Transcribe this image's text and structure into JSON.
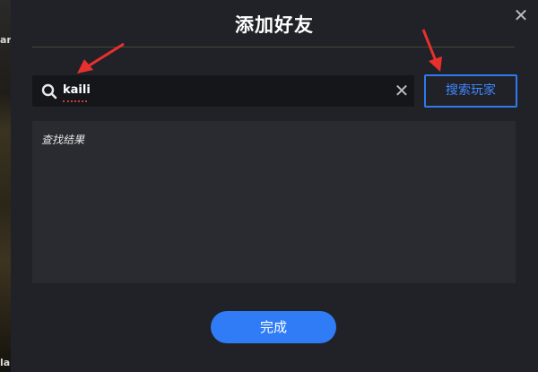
{
  "left_strip_text": [
    "ar",
    "la"
  ],
  "dialog": {
    "title": "添加好友",
    "close_icon": "close-icon"
  },
  "search": {
    "value": "kaili",
    "icon": "search-icon",
    "clear_icon": "clear-icon",
    "button_label": "搜索玩家"
  },
  "results": {
    "label": "查找结果"
  },
  "footer": {
    "done_label": "完成"
  },
  "colors": {
    "accent": "#2f7cf6",
    "annotation_red": "#e8302e"
  }
}
